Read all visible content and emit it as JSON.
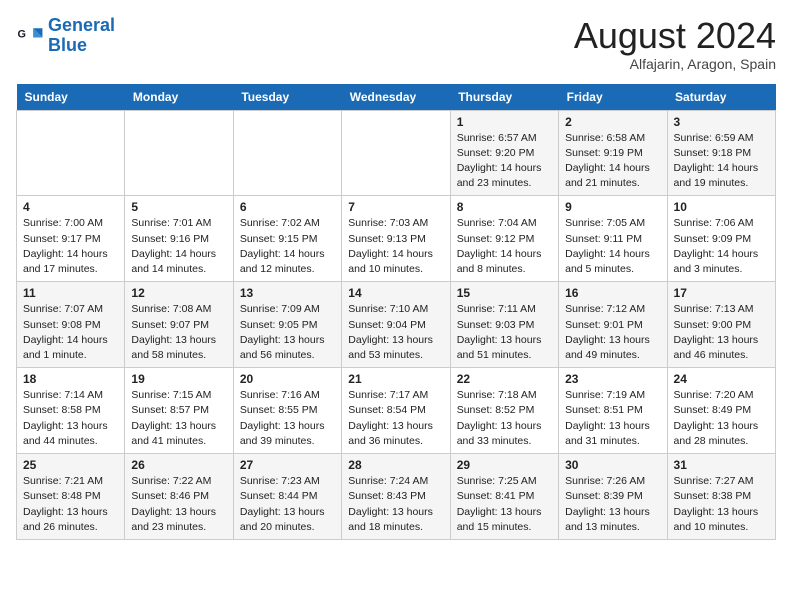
{
  "header": {
    "logo_line1": "General",
    "logo_line2": "Blue",
    "month_year": "August 2024",
    "location": "Alfajarin, Aragon, Spain"
  },
  "days_of_week": [
    "Sunday",
    "Monday",
    "Tuesday",
    "Wednesday",
    "Thursday",
    "Friday",
    "Saturday"
  ],
  "weeks": [
    [
      {
        "day": "",
        "info": ""
      },
      {
        "day": "",
        "info": ""
      },
      {
        "day": "",
        "info": ""
      },
      {
        "day": "",
        "info": ""
      },
      {
        "day": "1",
        "info": "Sunrise: 6:57 AM\nSunset: 9:20 PM\nDaylight: 14 hours\nand 23 minutes."
      },
      {
        "day": "2",
        "info": "Sunrise: 6:58 AM\nSunset: 9:19 PM\nDaylight: 14 hours\nand 21 minutes."
      },
      {
        "day": "3",
        "info": "Sunrise: 6:59 AM\nSunset: 9:18 PM\nDaylight: 14 hours\nand 19 minutes."
      }
    ],
    [
      {
        "day": "4",
        "info": "Sunrise: 7:00 AM\nSunset: 9:17 PM\nDaylight: 14 hours\nand 17 minutes."
      },
      {
        "day": "5",
        "info": "Sunrise: 7:01 AM\nSunset: 9:16 PM\nDaylight: 14 hours\nand 14 minutes."
      },
      {
        "day": "6",
        "info": "Sunrise: 7:02 AM\nSunset: 9:15 PM\nDaylight: 14 hours\nand 12 minutes."
      },
      {
        "day": "7",
        "info": "Sunrise: 7:03 AM\nSunset: 9:13 PM\nDaylight: 14 hours\nand 10 minutes."
      },
      {
        "day": "8",
        "info": "Sunrise: 7:04 AM\nSunset: 9:12 PM\nDaylight: 14 hours\nand 8 minutes."
      },
      {
        "day": "9",
        "info": "Sunrise: 7:05 AM\nSunset: 9:11 PM\nDaylight: 14 hours\nand 5 minutes."
      },
      {
        "day": "10",
        "info": "Sunrise: 7:06 AM\nSunset: 9:09 PM\nDaylight: 14 hours\nand 3 minutes."
      }
    ],
    [
      {
        "day": "11",
        "info": "Sunrise: 7:07 AM\nSunset: 9:08 PM\nDaylight: 14 hours\nand 1 minute."
      },
      {
        "day": "12",
        "info": "Sunrise: 7:08 AM\nSunset: 9:07 PM\nDaylight: 13 hours\nand 58 minutes."
      },
      {
        "day": "13",
        "info": "Sunrise: 7:09 AM\nSunset: 9:05 PM\nDaylight: 13 hours\nand 56 minutes."
      },
      {
        "day": "14",
        "info": "Sunrise: 7:10 AM\nSunset: 9:04 PM\nDaylight: 13 hours\nand 53 minutes."
      },
      {
        "day": "15",
        "info": "Sunrise: 7:11 AM\nSunset: 9:03 PM\nDaylight: 13 hours\nand 51 minutes."
      },
      {
        "day": "16",
        "info": "Sunrise: 7:12 AM\nSunset: 9:01 PM\nDaylight: 13 hours\nand 49 minutes."
      },
      {
        "day": "17",
        "info": "Sunrise: 7:13 AM\nSunset: 9:00 PM\nDaylight: 13 hours\nand 46 minutes."
      }
    ],
    [
      {
        "day": "18",
        "info": "Sunrise: 7:14 AM\nSunset: 8:58 PM\nDaylight: 13 hours\nand 44 minutes."
      },
      {
        "day": "19",
        "info": "Sunrise: 7:15 AM\nSunset: 8:57 PM\nDaylight: 13 hours\nand 41 minutes."
      },
      {
        "day": "20",
        "info": "Sunrise: 7:16 AM\nSunset: 8:55 PM\nDaylight: 13 hours\nand 39 minutes."
      },
      {
        "day": "21",
        "info": "Sunrise: 7:17 AM\nSunset: 8:54 PM\nDaylight: 13 hours\nand 36 minutes."
      },
      {
        "day": "22",
        "info": "Sunrise: 7:18 AM\nSunset: 8:52 PM\nDaylight: 13 hours\nand 33 minutes."
      },
      {
        "day": "23",
        "info": "Sunrise: 7:19 AM\nSunset: 8:51 PM\nDaylight: 13 hours\nand 31 minutes."
      },
      {
        "day": "24",
        "info": "Sunrise: 7:20 AM\nSunset: 8:49 PM\nDaylight: 13 hours\nand 28 minutes."
      }
    ],
    [
      {
        "day": "25",
        "info": "Sunrise: 7:21 AM\nSunset: 8:48 PM\nDaylight: 13 hours\nand 26 minutes."
      },
      {
        "day": "26",
        "info": "Sunrise: 7:22 AM\nSunset: 8:46 PM\nDaylight: 13 hours\nand 23 minutes."
      },
      {
        "day": "27",
        "info": "Sunrise: 7:23 AM\nSunset: 8:44 PM\nDaylight: 13 hours\nand 20 minutes."
      },
      {
        "day": "28",
        "info": "Sunrise: 7:24 AM\nSunset: 8:43 PM\nDaylight: 13 hours\nand 18 minutes."
      },
      {
        "day": "29",
        "info": "Sunrise: 7:25 AM\nSunset: 8:41 PM\nDaylight: 13 hours\nand 15 minutes."
      },
      {
        "day": "30",
        "info": "Sunrise: 7:26 AM\nSunset: 8:39 PM\nDaylight: 13 hours\nand 13 minutes."
      },
      {
        "day": "31",
        "info": "Sunrise: 7:27 AM\nSunset: 8:38 PM\nDaylight: 13 hours\nand 10 minutes."
      }
    ]
  ]
}
